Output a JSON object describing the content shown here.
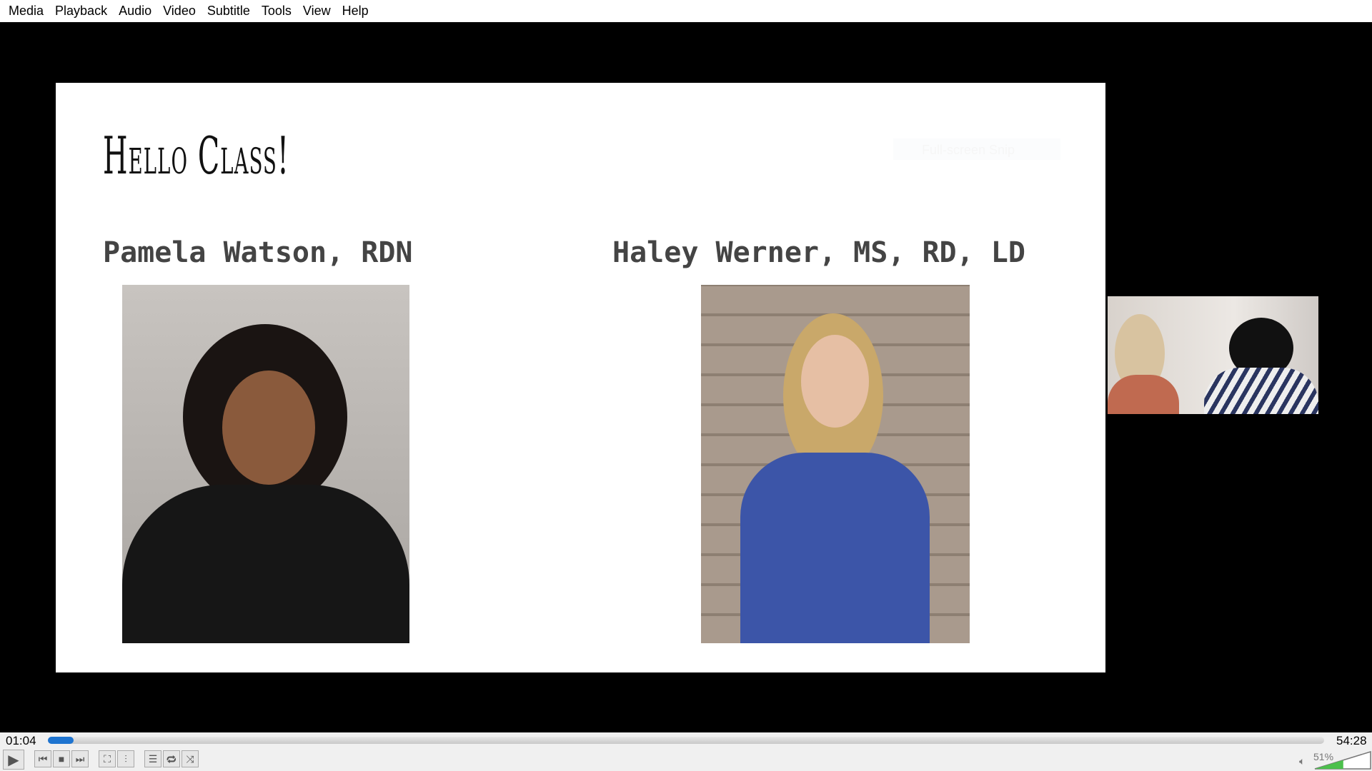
{
  "menu": [
    "Media",
    "Playback",
    "Audio",
    "Video",
    "Subtitle",
    "Tools",
    "View",
    "Help"
  ],
  "slide": {
    "title": "Hello Class!",
    "presenter1": "Pamela Watson, RDN",
    "presenter2": "Haley Werner, MS, RD, LD",
    "overlay": "Full-screen Snip"
  },
  "player": {
    "elapsed": "01:04",
    "total": "54:28",
    "progress_fraction": 0.0196,
    "volume": "51%",
    "volume_fraction": 0.51,
    "accent": "#1e74d0"
  },
  "buttons": [
    "play-icon",
    "previous-icon",
    "stop-icon",
    "next-icon",
    "fullscreen-icon",
    "extended-settings-icon",
    "playlist-icon",
    "loop-icon",
    "shuffle-icon"
  ]
}
